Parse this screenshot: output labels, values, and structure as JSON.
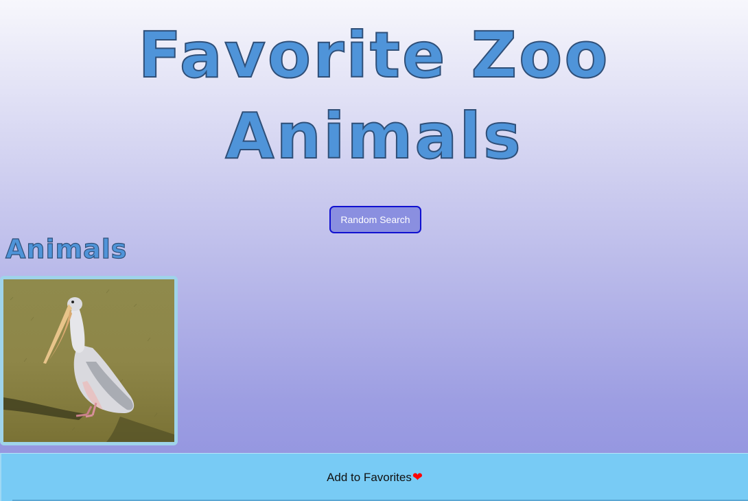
{
  "header": {
    "title_line1": "Favorite Zoo",
    "title_line2": "Animals"
  },
  "controls": {
    "random_search_label": "Random Search"
  },
  "animals_section": {
    "heading": "Animals",
    "cards": [
      {
        "image_subject": "pelican standing on grass"
      }
    ]
  },
  "favorites_bar": {
    "label": "Add to Favorites",
    "icon": "heart-icon",
    "heart_glyph": "❤"
  },
  "colors": {
    "title_fill": "#4f94d9",
    "button_border": "#1010d0",
    "favorites_bar_bg": "#78cbf5",
    "heart": "#ff0000"
  }
}
